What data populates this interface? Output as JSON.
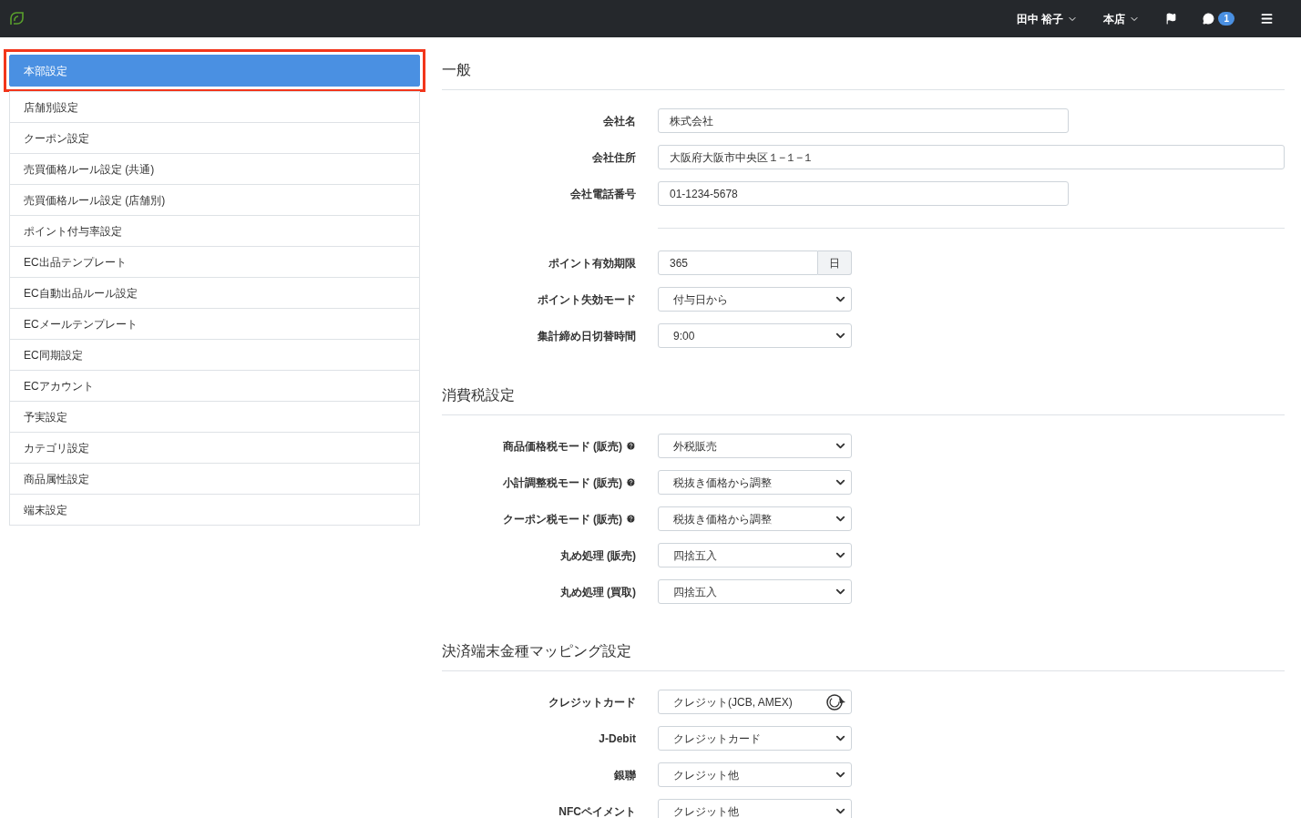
{
  "topbar": {
    "user": "田中 裕子",
    "store": "本店",
    "messages_badge": "1"
  },
  "sidebar": {
    "items": [
      {
        "label": "本部設定",
        "selected": true
      },
      {
        "label": "店舗別設定",
        "selected": false
      },
      {
        "label": "クーポン設定",
        "selected": false
      },
      {
        "label": "売買価格ルール設定 (共通)",
        "selected": false
      },
      {
        "label": "売買価格ルール設定 (店舗別)",
        "selected": false
      },
      {
        "label": "ポイント付与率設定",
        "selected": false
      },
      {
        "label": "EC出品テンプレート",
        "selected": false
      },
      {
        "label": "EC自動出品ルール設定",
        "selected": false
      },
      {
        "label": "ECメールテンプレート",
        "selected": false
      },
      {
        "label": "EC同期設定",
        "selected": false
      },
      {
        "label": "ECアカウント",
        "selected": false
      },
      {
        "label": "予実設定",
        "selected": false
      },
      {
        "label": "カテゴリ設定",
        "selected": false
      },
      {
        "label": "商品属性設定",
        "selected": false
      },
      {
        "label": "端末設定",
        "selected": false
      }
    ]
  },
  "sections": [
    {
      "title": "一般",
      "groups": [
        [
          {
            "label": "会社名",
            "kind": "text",
            "value": "株式会社"
          },
          {
            "label": "会社住所",
            "kind": "wide",
            "value": "大阪府大阪市中央区１−１−１"
          },
          {
            "label": "会社電話番号",
            "kind": "text",
            "value": "01-1234-5678"
          }
        ],
        [
          {
            "label": "ポイント有効期限",
            "kind": "addon",
            "value": "365",
            "addon": "日"
          },
          {
            "label": "ポイント失効モード",
            "kind": "select",
            "value": "付与日から"
          },
          {
            "label": "集計締め日切替時間",
            "kind": "select",
            "value": "9:00"
          }
        ]
      ]
    },
    {
      "title": "消費税設定",
      "groups": [
        [
          {
            "label": "商品価格税モード (販売)",
            "help": true,
            "kind": "select",
            "value": "外税販売"
          },
          {
            "label": "小計調整税モード (販売)",
            "help": true,
            "kind": "select",
            "value": "税抜き価格から調整"
          },
          {
            "label": "クーポン税モード (販売)",
            "help": true,
            "kind": "select",
            "value": "税抜き価格から調整"
          },
          {
            "label": "丸め処理 (販売)",
            "help": false,
            "kind": "select",
            "value": "四捨五入"
          },
          {
            "label": "丸め処理 (買取)",
            "help": false,
            "kind": "select",
            "value": "四捨五入"
          }
        ]
      ]
    },
    {
      "title": "決済端末金種マッピング設定",
      "groups": [
        [
          {
            "label": "クレジットカード",
            "kind": "busy",
            "value": "クレジット(JCB, AMEX)"
          },
          {
            "label": "J-Debit",
            "kind": "select",
            "value": "クレジットカード"
          },
          {
            "label": "銀聯",
            "kind": "select",
            "value": "クレジット他"
          },
          {
            "label": "NFCペイメント",
            "kind": "select",
            "value": "クレジット他"
          }
        ]
      ]
    }
  ]
}
